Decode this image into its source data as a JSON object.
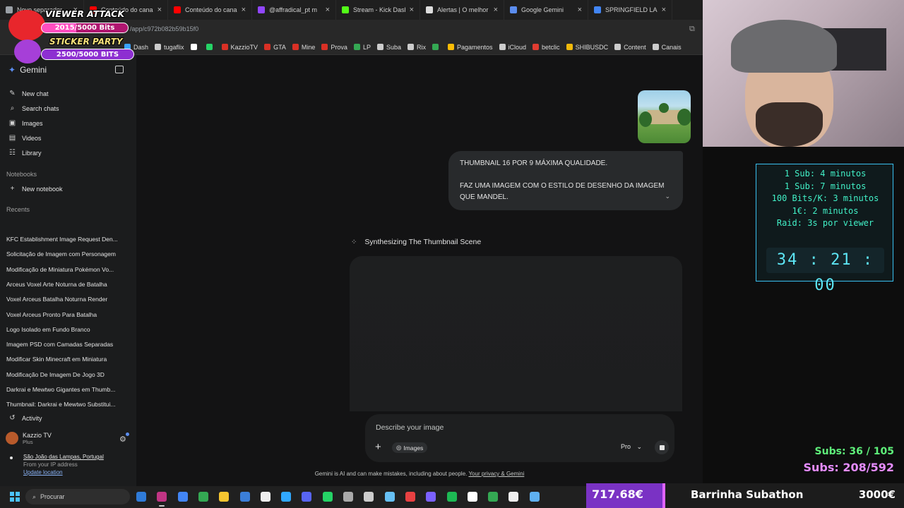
{
  "browser": {
    "tabs": [
      {
        "label": "Novo separador",
        "color": "#9aa0a6"
      },
      {
        "label": "Conteúdo do canal -",
        "color": "#ff0000"
      },
      {
        "label": "Conteúdo do canal -",
        "color": "#ff0000"
      },
      {
        "label": "@affradical_pt m",
        "color": "#9146ff"
      },
      {
        "label": "Stream - Kick Dashb",
        "color": "#53fc18"
      },
      {
        "label": "Alertas | O melhor s",
        "color": "#dddddd"
      },
      {
        "label": "Google Gemini",
        "color": "#5b8def"
      },
      {
        "label": "SPRINGFIELD LAND",
        "color": "#4285f4"
      }
    ],
    "address": "/app/c972b082b59b15f0",
    "bookmarks": [
      {
        "label": "Dash",
        "color": "#3aa3ff"
      },
      {
        "label": "tugaflix",
        "color": "#cccccc"
      },
      {
        "label": "",
        "color": "#ffffff"
      },
      {
        "label": "",
        "color": "#25d366"
      },
      {
        "label": "KazzioTV",
        "color": "#d93025"
      },
      {
        "label": "GTA",
        "color": "#d93025"
      },
      {
        "label": "Mine",
        "color": "#d93025"
      },
      {
        "label": "Prova",
        "color": "#d93025"
      },
      {
        "label": "LP",
        "color": "#34a853"
      },
      {
        "label": "Suba",
        "color": "#cccccc"
      },
      {
        "label": "Rix",
        "color": "#cccccc"
      },
      {
        "label": "",
        "color": "#34a853"
      },
      {
        "label": "Pagamentos",
        "color": "#fbbc05"
      },
      {
        "label": "iCloud",
        "color": "#cccccc"
      },
      {
        "label": "betclic",
        "color": "#e03c31"
      },
      {
        "label": "SHIBUSDC",
        "color": "#f0b90b"
      },
      {
        "label": "Content",
        "color": "#cccccc"
      },
      {
        "label": "Canais",
        "color": "#cccccc"
      }
    ]
  },
  "sidebar": {
    "title": "Gemini",
    "nav": [
      {
        "label": "New chat",
        "icon": "edit-icon",
        "glyph": "✎"
      },
      {
        "label": "Search chats",
        "icon": "search-icon",
        "glyph": "⌕"
      },
      {
        "label": "Images",
        "icon": "image-icon",
        "glyph": "▣"
      },
      {
        "label": "Videos",
        "icon": "video-icon",
        "glyph": "▤"
      },
      {
        "label": "Library",
        "icon": "library-icon",
        "glyph": "☷"
      }
    ],
    "notebooks_label": "Notebooks",
    "new_notebook": "New notebook",
    "recents_label": "Recents",
    "recents": [
      "KFC Establishment Image Request Den...",
      "Solicitação de Imagem com Personagem",
      "Modificação de Miniatura Pokémon Vo...",
      "Arceus Voxel Arte Noturna de Batalha",
      "Voxel Arceus Batalha Noturna Render",
      "Voxel Arceus Pronto Para Batalha",
      "Logo Isolado em Fundo Branco",
      "Imagem PSD com Camadas Separadas",
      "Modificar Skin Minecraft em Miniatura",
      "Modificação De Imagem De Jogo 3D",
      "Darkrai e Mewtwo Gigantes em Thumb...",
      "Thumbnail: Darkrai e Mewtwo Substitui..."
    ],
    "activity": "Activity",
    "user_name": "Kazzio TV",
    "user_plan": "Plus",
    "location": "São João das Lampas, Portugal",
    "location_source": "From your IP address",
    "update_location": "Update location"
  },
  "chat": {
    "user_message_line1": "THUMBNAIL 16 POR 9 MÁXIMA QUALIDADE.",
    "user_message_line2": "FAZ UMA IMAGEM COM O ESTILO DE DESENHO DA IMAGEM QUE MANDEL.",
    "thinking_status": "Synthesizing The Thumbnail Scene",
    "input_placeholder": "Describe your image",
    "images_chip": "Images",
    "model": "Pro",
    "disclaimer": "Gemini is AI and can make mistakes, including about people.",
    "privacy_link": "Your privacy & Gemini"
  },
  "taskbar": {
    "search_placeholder": "Procurar"
  },
  "overlays": {
    "viewer_attack_title": "VIEWER ATTACK",
    "viewer_attack_progress": "2015/5000 Bits",
    "viewer_attack_fraction": 0.403,
    "sticker_party_title": "STICKER PARTY",
    "sticker_party_progress": "2500/5000 BITS",
    "sticker_party_fraction": 0.5,
    "timer_rules": [
      "1 Sub: 4 minutos",
      "1 Sub: 7 minutos",
      "100 Bits/K: 3 minutos",
      "1€: 2 minutos",
      "Raid: 3s por viewer"
    ],
    "timer_clock": "34 : 21 : 00",
    "subs_line1": "Subs: 36 / 105",
    "subs_line2": "Subs: 208/592",
    "subathon_value": "717.68€",
    "subathon_title": "Barrinha Subathon",
    "subathon_goal": "3000€",
    "subathon_fraction": 0.239,
    "colors": {
      "sub_green": "#5ef07a",
      "sub_pink": "#e58cff",
      "heart_red": "#e8262c",
      "heart_purple": "#a63fd8"
    }
  }
}
